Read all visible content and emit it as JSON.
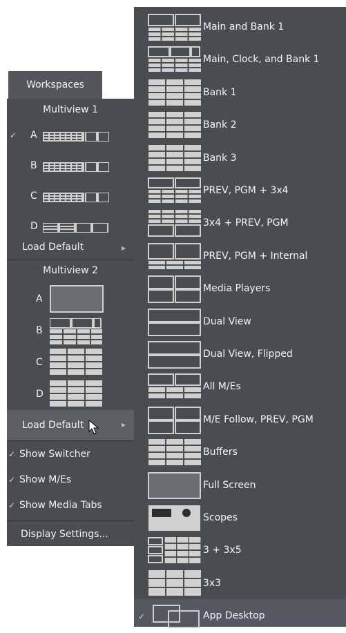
{
  "workspaces_button": "Workspaces",
  "multiview1": {
    "title": "Multiview 1",
    "items": [
      {
        "label": "A",
        "checked": true
      },
      {
        "label": "B",
        "checked": false
      },
      {
        "label": "C",
        "checked": false
      },
      {
        "label": "D",
        "checked": false
      }
    ],
    "load_default": "Load Default"
  },
  "multiview2": {
    "title": "Multiview 2",
    "items": [
      {
        "label": "A"
      },
      {
        "label": "B"
      },
      {
        "label": "C"
      },
      {
        "label": "D"
      }
    ],
    "load_default": "Load Default"
  },
  "options": [
    {
      "label": "Show Switcher",
      "checked": true
    },
    {
      "label": "Show M/Es",
      "checked": true
    },
    {
      "label": "Show Media Tabs",
      "checked": true
    }
  ],
  "display_settings": "Display Settings...",
  "layouts": [
    {
      "label": "Main and Bank 1",
      "icon": "layout-main-bank-icon"
    },
    {
      "label": "Main, Clock, and Bank 1",
      "icon": "layout-main-clock-bank-icon"
    },
    {
      "label": "Bank 1",
      "icon": "layout-bank-icon"
    },
    {
      "label": "Bank 2",
      "icon": "layout-bank-icon"
    },
    {
      "label": "Bank 3",
      "icon": "layout-bank-icon"
    },
    {
      "label": "PREV, PGM + 3x4",
      "icon": "layout-prev-pgm-3x4-icon"
    },
    {
      "label": "3x4 + PREV, PGM",
      "icon": "layout-3x4-prev-pgm-icon"
    },
    {
      "label": "PREV, PGM + Internal",
      "icon": "layout-prev-pgm-internal-icon"
    },
    {
      "label": "Media Players",
      "icon": "layout-media-players-icon"
    },
    {
      "label": "Dual View",
      "icon": "layout-dual-view-icon"
    },
    {
      "label": "Dual View, Flipped",
      "icon": "layout-dual-view-flipped-icon"
    },
    {
      "label": "All M/Es",
      "icon": "layout-all-mes-icon"
    },
    {
      "label": "M/E Follow, PREV, PGM",
      "icon": "layout-me-follow-icon"
    },
    {
      "label": "Buffers",
      "icon": "layout-buffers-icon"
    },
    {
      "label": "Full Screen",
      "icon": "layout-full-screen-icon"
    },
    {
      "label": "Scopes",
      "icon": "layout-scopes-icon"
    },
    {
      "label": "3 + 3x5",
      "icon": "layout-3-3x5-icon"
    },
    {
      "label": "3x3",
      "icon": "layout-3x3-icon"
    },
    {
      "label": "App Desktop",
      "icon": "layout-app-desktop-icon",
      "checked": true
    }
  ]
}
